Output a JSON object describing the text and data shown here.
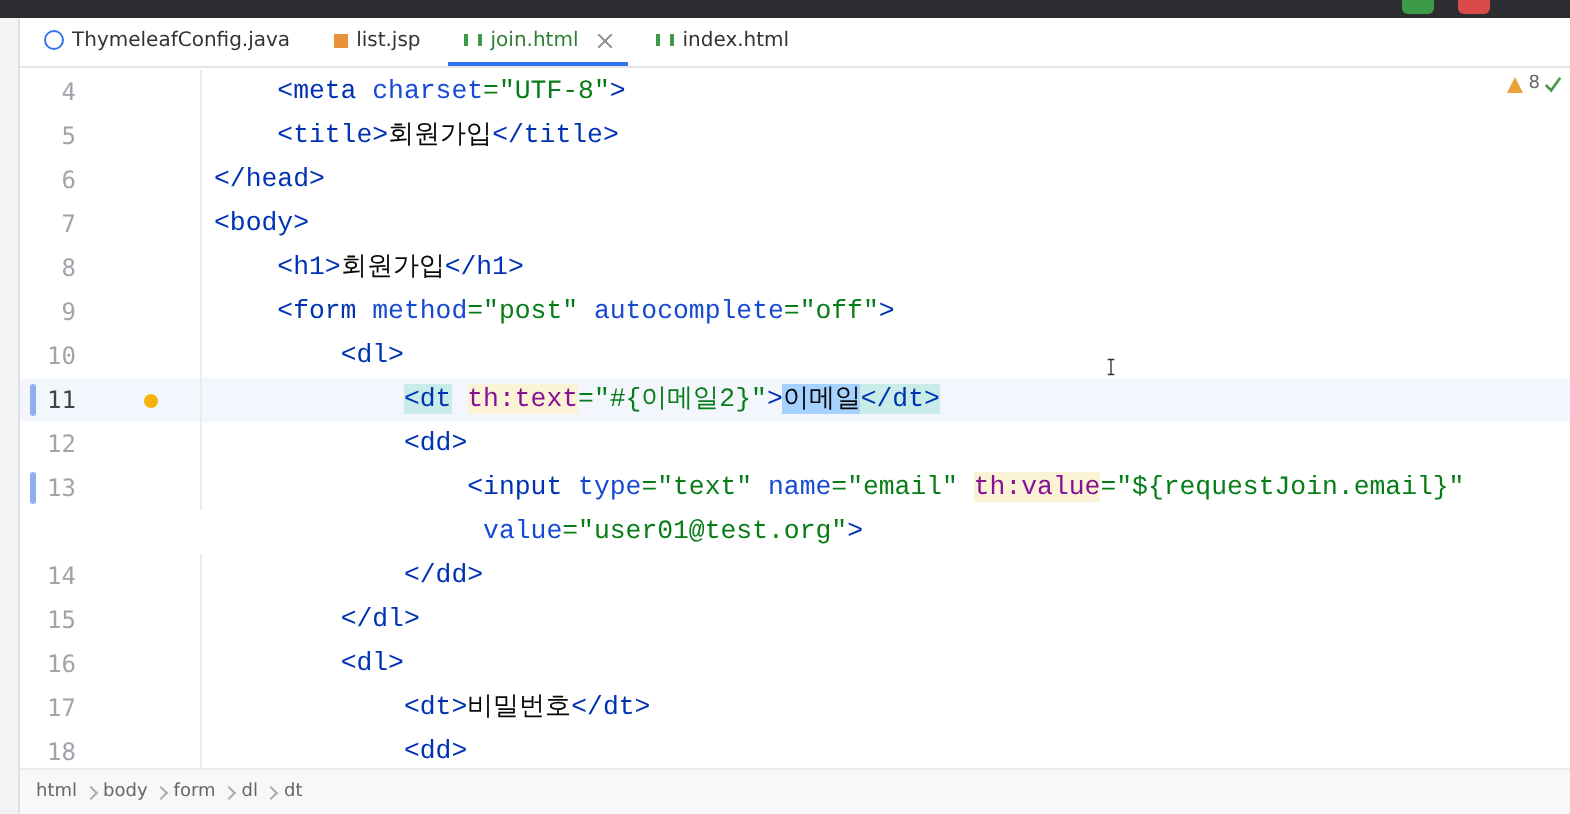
{
  "tabs": [
    {
      "label": "ThymeleafConfig.java",
      "kind": "java",
      "selected": false,
      "closable": false
    },
    {
      "label": "list.jsp",
      "kind": "jsp",
      "selected": false,
      "closable": false
    },
    {
      "label": "join.html",
      "kind": "html",
      "selected": true,
      "closable": true
    },
    {
      "label": "index.html",
      "kind": "html",
      "selected": false,
      "closable": false
    }
  ],
  "inspections": {
    "warnings": "8"
  },
  "lines": [
    {
      "number": "4",
      "current": false,
      "changed": false,
      "tokens": [
        {
          "kind": "tag",
          "text": "    <meta "
        },
        {
          "kind": "attr",
          "text": "charset"
        },
        {
          "kind": "value",
          "text": "=\"UTF-8\""
        },
        {
          "kind": "tag",
          "text": ">"
        }
      ]
    },
    {
      "number": "5",
      "current": false,
      "changed": false,
      "tokens": [
        {
          "kind": "tag",
          "text": "    <title>"
        },
        {
          "kind": "plain",
          "text": "회원가입"
        },
        {
          "kind": "tag",
          "text": "</title>"
        }
      ]
    },
    {
      "number": "6",
      "current": false,
      "changed": false,
      "tokens": [
        {
          "kind": "tag",
          "text": "</head>"
        }
      ]
    },
    {
      "number": "7",
      "current": false,
      "changed": false,
      "tokens": [
        {
          "kind": "tag",
          "text": "<body>"
        }
      ]
    },
    {
      "number": "8",
      "current": false,
      "changed": false,
      "tokens": [
        {
          "kind": "tag",
          "text": "    <h1>"
        },
        {
          "kind": "plain",
          "text": "회원가입"
        },
        {
          "kind": "tag",
          "text": "</h1>"
        }
      ]
    },
    {
      "number": "9",
      "current": false,
      "changed": false,
      "tokens": [
        {
          "kind": "tag",
          "text": "    <form "
        },
        {
          "kind": "attr",
          "text": "method"
        },
        {
          "kind": "value",
          "text": "=\"post\" "
        },
        {
          "kind": "attr",
          "text": "autocomplete"
        },
        {
          "kind": "value",
          "text": "=\"off\""
        },
        {
          "kind": "tag",
          "text": ">"
        }
      ]
    },
    {
      "number": "10",
      "current": false,
      "changed": false,
      "tokens": [
        {
          "kind": "tag",
          "text": "        <dl>"
        }
      ]
    },
    {
      "number": "11",
      "current": true,
      "changed": true,
      "hint": true,
      "tokens": [
        {
          "kind": "matched",
          "text": "            <dt"
        },
        {
          "kind": "thattr",
          "text": "th:text",
          "gap": true
        },
        {
          "kind": "value",
          "text": "=\"#{이메일2}\""
        },
        {
          "kind": "tag",
          "text": ">"
        },
        {
          "kind": "selected",
          "text": "이메일"
        },
        {
          "kind": "matched",
          "text": "</dt>"
        }
      ]
    },
    {
      "number": "12",
      "current": false,
      "changed": false,
      "tokens": [
        {
          "kind": "tag",
          "text": "            <dd>"
        }
      ]
    },
    {
      "number": "13",
      "current": false,
      "changed": true,
      "tokens": [
        {
          "kind": "tag",
          "text": "                <input "
        },
        {
          "kind": "attr",
          "text": "type"
        },
        {
          "kind": "value",
          "text": "=\"text\" "
        },
        {
          "kind": "attr",
          "text": "name"
        },
        {
          "kind": "value",
          "text": "=\"email\" "
        },
        {
          "kind": "thattr",
          "text": "th:value"
        },
        {
          "kind": "value",
          "text": "=\"${requestJoin.email}\""
        }
      ],
      "wrapped": [
        {
          "kind": "attr",
          "text": "                 value"
        },
        {
          "kind": "value",
          "text": "=\"user01@test.org\""
        },
        {
          "kind": "tag",
          "text": ">"
        }
      ]
    },
    {
      "number": "14",
      "current": false,
      "changed": false,
      "tokens": [
        {
          "kind": "tag",
          "text": "            </dd>"
        }
      ]
    },
    {
      "number": "15",
      "current": false,
      "changed": false,
      "tokens": [
        {
          "kind": "tag",
          "text": "        </dl>"
        }
      ]
    },
    {
      "number": "16",
      "current": false,
      "changed": false,
      "tokens": [
        {
          "kind": "tag",
          "text": "        <dl>"
        }
      ]
    },
    {
      "number": "17",
      "current": false,
      "changed": false,
      "tokens": [
        {
          "kind": "tag",
          "text": "            <dt>"
        },
        {
          "kind": "plain",
          "text": "비밀번호"
        },
        {
          "kind": "tag",
          "text": "</dt>"
        }
      ]
    },
    {
      "number": "18",
      "current": false,
      "changed": false,
      "tokens": [
        {
          "kind": "tag",
          "text": "            <dd>"
        }
      ]
    }
  ],
  "breadcrumbs": [
    "html",
    "body",
    "form",
    "dl",
    "dt"
  ]
}
